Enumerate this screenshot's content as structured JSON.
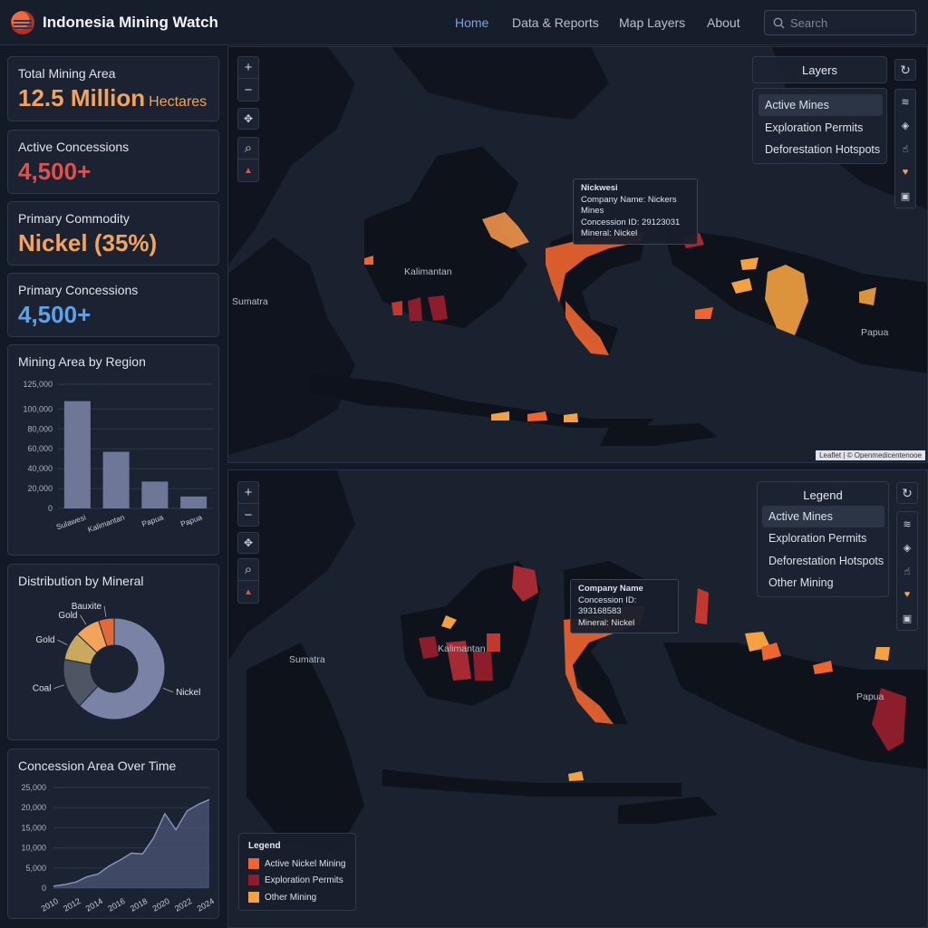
{
  "header": {
    "title": "Indonesia Mining Watch",
    "nav": [
      "Home",
      "Data & Reports",
      "Map Layers",
      "About"
    ],
    "active_nav": "Home",
    "search_placeholder": "Search"
  },
  "stats": [
    {
      "label": "Total Mining Area",
      "value": "12.5 Million",
      "unit": "Hectares",
      "color": "#f3a35b"
    },
    {
      "label": "Active Concessions",
      "value": "4,500+",
      "unit": "",
      "color": "#e0504e"
    },
    {
      "label": "Primary Commodity",
      "value": "Nickel (35%)",
      "unit": "",
      "color": "#f3a35b"
    },
    {
      "label": "Primary Concessions",
      "value": "4,500+",
      "unit": "",
      "color": "#5da3ea"
    }
  ],
  "charts": {
    "region_title": "Mining Area by Region",
    "mineral_title": "Distribution by Mineral",
    "time_title": "Concession Area Over Time"
  },
  "chart_data": [
    {
      "type": "bar",
      "title": "Mining Area by Region",
      "categories": [
        "Sulawesi",
        "Kalimantan",
        "Papua",
        "Papua"
      ],
      "tick_labels": [
        "Sulawesi",
        "Kalimantan",
        "Papua",
        "Papua"
      ],
      "values": [
        108000,
        57000,
        27000,
        12000
      ],
      "ylim": [
        0,
        125000
      ],
      "yticks": [
        "125,000",
        "100,000",
        "80,000",
        "60,000",
        "40,000",
        "20,000",
        "0"
      ],
      "grid": true
    },
    {
      "type": "pie",
      "title": "Distribution by Mineral",
      "categories": [
        "Nickel",
        "Coal",
        "Gold",
        "Gold",
        "Bauxite"
      ],
      "values": [
        62,
        16,
        9,
        8,
        5
      ],
      "colors": [
        "#7a82a6",
        "#4e5563",
        "#c9a95c",
        "#f3a35b",
        "#e06a3a"
      ]
    },
    {
      "type": "area",
      "title": "Concession Area Over Time",
      "x": [
        2010,
        2011,
        2012,
        2013,
        2014,
        2015,
        2016,
        2017,
        2018,
        2019,
        2020,
        2021,
        2022,
        2023,
        2024
      ],
      "values": [
        500,
        900,
        1500,
        2800,
        3500,
        5500,
        7000,
        8700,
        8500,
        12500,
        18500,
        14500,
        19200,
        20800,
        22000
      ],
      "ylim": [
        0,
        25000
      ],
      "yticks": [
        "25,000",
        "20,000",
        "15,000",
        "10,000",
        "5,000",
        "0"
      ],
      "xticks": [
        "2010",
        "2012",
        "2014",
        "2016",
        "2018",
        "2020",
        "2022",
        "2024"
      ],
      "grid": true
    }
  ],
  "map_top": {
    "panel_title": "Layers",
    "items": [
      "Active Mines",
      "Exploration Permits",
      "Deforestation Hotspots"
    ],
    "selected": "Active Mines",
    "tooltip": {
      "title": "Nickwesi",
      "lines": [
        "Company Name: Nickers Mines",
        "Concession ID: 29123031",
        "Mineral: Nickel"
      ]
    },
    "labels": [
      "Kalimantan",
      "Sumatra",
      "Papua"
    ],
    "attribution": "Leaflet | © Openmedicentenooe"
  },
  "map_bottom": {
    "panel_title": "Legend",
    "items": [
      "Active Mines",
      "Exploration Permits",
      "Deforestation Hotspots",
      "Other Mining"
    ],
    "selected": "Active Mines",
    "tooltip": {
      "title": "Company Name",
      "lines": [
        "Concession ID: 393168583",
        "Mineral: Nickel"
      ]
    },
    "labels": [
      "Kalimantan",
      "Sumatra",
      "Papua"
    ]
  },
  "legend": {
    "title": "Legend",
    "items": [
      {
        "label": "Active Nickel Mining",
        "color": "#f0652f"
      },
      {
        "label": "Exploration Permits",
        "color": "#8e1d2c"
      },
      {
        "label": "Other Mining",
        "color": "#f3a23f"
      }
    ]
  },
  "colors": {
    "accent": "#7aa3e8",
    "background": "#131a27",
    "panel": "#1b2332"
  }
}
